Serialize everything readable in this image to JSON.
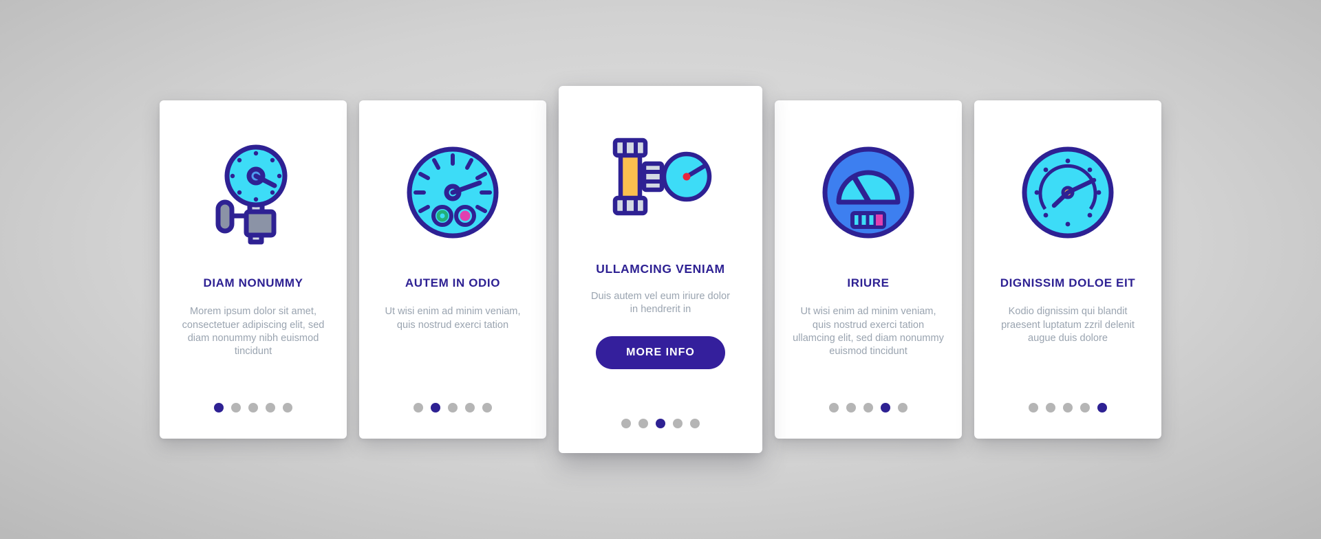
{
  "page": {
    "background_color": "#d4d4d4",
    "accent_color": "#2e2193",
    "body_text_color": "#9aa4b0",
    "icon_cyan": "#3ddcf7",
    "icon_outline": "#2e2193"
  },
  "cards": [
    {
      "id": "card-diam-nonummy",
      "icon_name": "pressure-gauge-valve-icon",
      "title": "DIAM NONUMMY",
      "body": "Morem ipsum dolor sit amet, consectetuer adipiscing elit, sed diam nonummy nibh euismod tincidunt",
      "featured": false,
      "button_label": null,
      "dots": {
        "count": 5,
        "active_index": 0
      }
    },
    {
      "id": "card-autem-in-odio",
      "icon_name": "speedometer-dial-icon",
      "title": "AUTEM IN ODIO",
      "body": "Ut wisi enim ad minim veniam, quis nostrud exerci tation",
      "featured": false,
      "button_label": null,
      "dots": {
        "count": 5,
        "active_index": 1
      }
    },
    {
      "id": "card-ullamcing-veniam",
      "icon_name": "pipe-valve-manometer-icon",
      "title": "ULLAMCING VENIAM",
      "body": "Duis autem vel eum iriure dolor in hendrerit in",
      "featured": true,
      "button_label": "MORE INFO",
      "dots": {
        "count": 5,
        "active_index": 2
      }
    },
    {
      "id": "card-iriure",
      "icon_name": "fuel-gauge-icon",
      "title": "IRIURE",
      "body": "Ut wisi enim ad minim veniam, quis nostrud exerci tation ullamcing elit, sed diam nonummy euismod tincidunt",
      "featured": false,
      "button_label": null,
      "dots": {
        "count": 5,
        "active_index": 3
      }
    },
    {
      "id": "card-dignissim-doloe-eit",
      "icon_name": "barometer-dial-icon",
      "title": "DIGNISSIM DOLOE EIT",
      "body": "Kodio dignissim qui blandit praesent luptatum zzril delenit augue duis dolore",
      "featured": false,
      "button_label": null,
      "dots": {
        "count": 5,
        "active_index": 4
      }
    }
  ]
}
